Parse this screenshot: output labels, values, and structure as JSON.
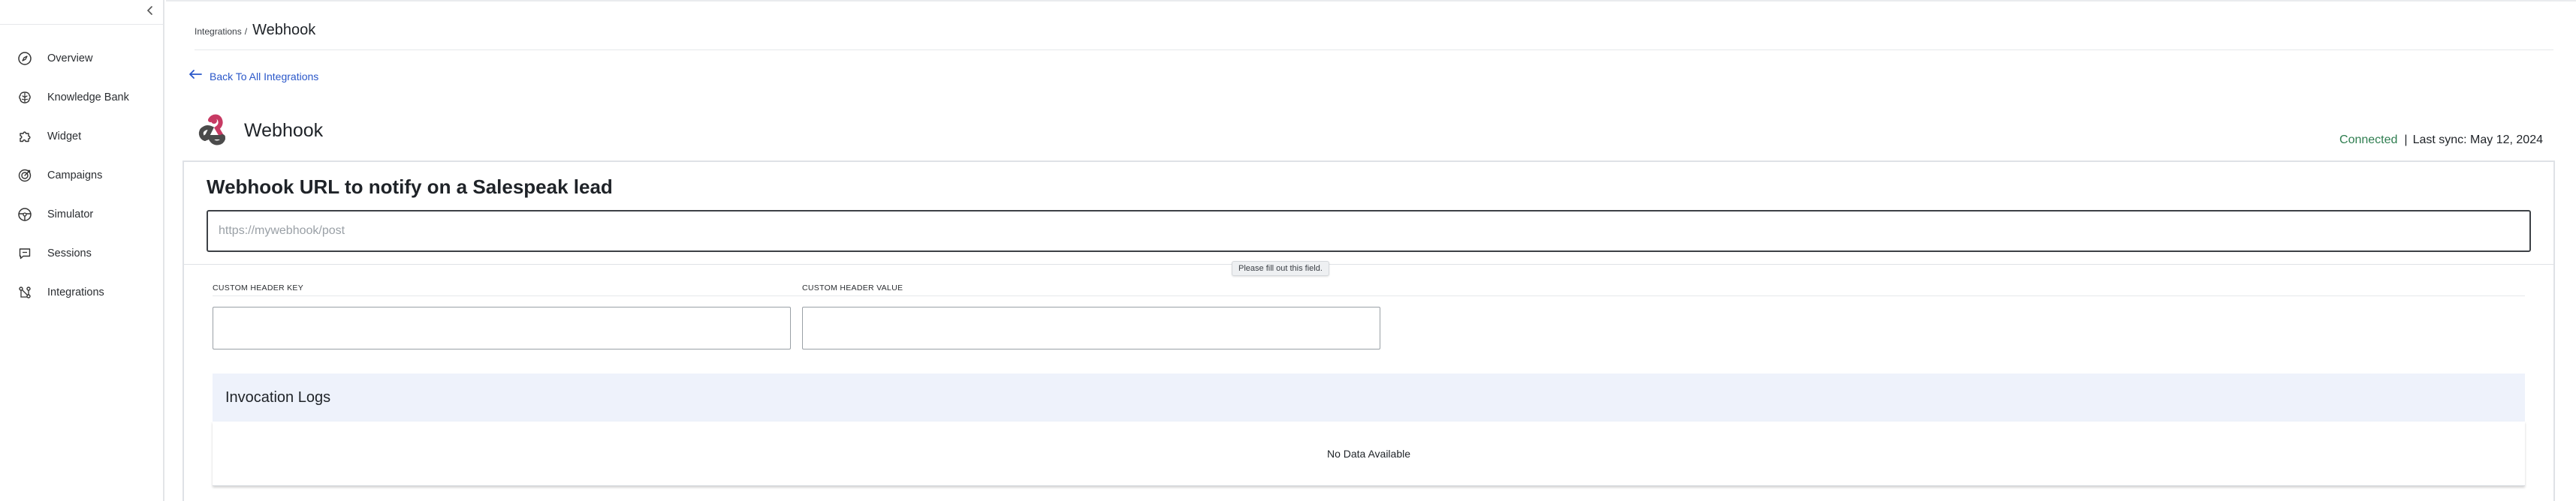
{
  "sidebar": {
    "items": [
      {
        "label": "Overview",
        "icon": "compass-icon"
      },
      {
        "label": "Knowledge Bank",
        "icon": "brain-icon"
      },
      {
        "label": "Widget",
        "icon": "puzzle-icon"
      },
      {
        "label": "Campaigns",
        "icon": "target-icon"
      },
      {
        "label": "Simulator",
        "icon": "steering-wheel-icon"
      },
      {
        "label": "Sessions",
        "icon": "chat-bubble-icon"
      },
      {
        "label": "Integrations",
        "icon": "integrations-icon"
      }
    ]
  },
  "breadcrumb": {
    "parent": "Integrations",
    "separator": "/",
    "current": "Webhook"
  },
  "back_link": {
    "label": "Back To All Integrations"
  },
  "integration": {
    "title": "Webhook",
    "status": "Connected",
    "status_separator": "|",
    "last_sync": "Last sync: May 12, 2024"
  },
  "webhook_url": {
    "heading": "Webhook URL to notify on a Salespeak lead",
    "value": "",
    "placeholder": "https://mywebhook/post",
    "validation_tooltip": "Please fill out this field."
  },
  "custom_headers": {
    "key_label": "CUSTOM HEADER KEY",
    "value_label": "CUSTOM HEADER VALUE",
    "key_value": "",
    "value_value": ""
  },
  "invocation_logs": {
    "title": "Invocation Logs",
    "empty_message": "No Data Available"
  },
  "colors": {
    "accent_link": "#2a57c9",
    "status_connected": "#2e7d4f",
    "logs_header_bg": "#eef2fb",
    "webhook_logo": "#c73a63"
  }
}
